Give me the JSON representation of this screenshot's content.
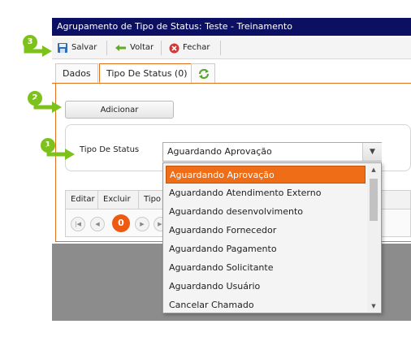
{
  "window": {
    "title": "Agrupamento de Tipo de Status:  Teste - Treinamento"
  },
  "toolbar": {
    "save_label": "Salvar",
    "back_label": "Voltar",
    "close_label": "Fechar"
  },
  "tabs": [
    {
      "label": "Dados"
    },
    {
      "label": "Tipo De Status (0)"
    }
  ],
  "form": {
    "add_label": "Adicionar",
    "field_label": "Tipo De Status",
    "selected_value": "Aguardando Aprovação"
  },
  "grid": {
    "columns": [
      "Editar",
      "Excluir",
      "Tipo"
    ]
  },
  "pager": {
    "current_page": "0"
  },
  "dropdown": {
    "options": [
      "Aguardando Aprovação",
      "Aguardando Atendimento Externo",
      "Aguardando desenvolvimento",
      "Aguardando Fornecedor",
      "Aguardando Pagamento",
      "Aguardando Solicitante",
      "Aguardando Usuário",
      "Cancelar Chamado"
    ]
  },
  "callouts": [
    "1",
    "2",
    "3"
  ],
  "colors": {
    "titlebar": "#0b1063",
    "accent": "#ef6d16",
    "callout": "#7cc21b",
    "overlay": "#8c8c8c"
  }
}
